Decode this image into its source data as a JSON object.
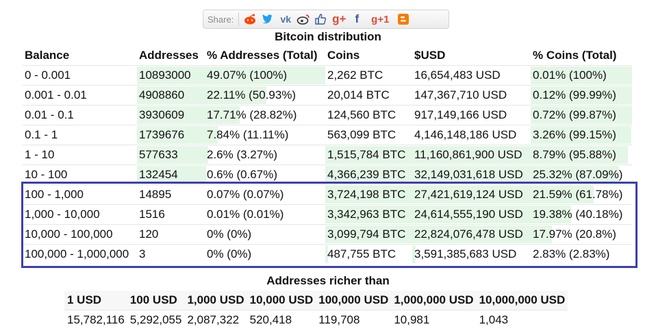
{
  "share": {
    "label": "Share:",
    "buttons": [
      {
        "name": "reddit-icon",
        "color": "#ff4500"
      },
      {
        "name": "twitter-icon",
        "color": "#1da1f2"
      },
      {
        "name": "vk-icon",
        "color": "#4c75a3"
      },
      {
        "name": "weibo-icon",
        "color": "#e6162d"
      },
      {
        "name": "like-icon",
        "color": "#3b5998"
      },
      {
        "name": "google-plus-icon",
        "color": "#dd4b39"
      },
      {
        "name": "facebook-icon",
        "color": "#3b5998"
      },
      {
        "name": "google-plus-one-icon",
        "color": "#dd4b39"
      },
      {
        "name": "blogger-icon",
        "color": "#f57d00"
      }
    ]
  },
  "distribution": {
    "title": "Bitcoin distribution",
    "headers": [
      "Balance",
      "Addresses",
      "% Addresses (Total)",
      "Coins",
      "$USD",
      "% Coins (Total)"
    ],
    "bar_color": "#e4f6e6",
    "highlight_color": "#3d3fb0",
    "rows": [
      {
        "balance": "0 - 0.001",
        "addresses": "10893000",
        "pct_addresses": "49.07% (100%)",
        "coins": "2,262 BTC",
        "usd": "16,654,483 USD",
        "pct_coins": "0.01% (100%)",
        "addr_share": 1.0,
        "pct_share": 1.0,
        "coins_share": 0.0,
        "usd_share": 0.0,
        "pctc_share": 1.0
      },
      {
        "balance": "0.001 - 0.01",
        "addresses": "4908860",
        "pct_addresses": "22.11% (50.93%)",
        "coins": "20,014 BTC",
        "usd": "147,367,710 USD",
        "pct_coins": "0.12% (99.99%)",
        "addr_share": 1.0,
        "pct_share": 0.51,
        "coins_share": 0.0,
        "usd_share": 0.0,
        "pctc_share": 1.0
      },
      {
        "balance": "0.01 - 0.1",
        "addresses": "3930609",
        "pct_addresses": "17.71% (28.82%)",
        "coins": "124,560 BTC",
        "usd": "917,149,166 USD",
        "pct_coins": "0.72% (99.87%)",
        "addr_share": 1.0,
        "pct_share": 0.29,
        "coins_share": 0.0,
        "usd_share": 0.0,
        "pctc_share": 1.0
      },
      {
        "balance": "0.1 - 1",
        "addresses": "1739676",
        "pct_addresses": "7.84% (11.11%)",
        "coins": "563,099 BTC",
        "usd": "4,146,148,186 USD",
        "pct_coins": "3.26% (99.15%)",
        "addr_share": 1.0,
        "pct_share": 0.11,
        "coins_share": 0.0,
        "usd_share": 0.0,
        "pctc_share": 0.99
      },
      {
        "balance": "1 - 10",
        "addresses": "577633",
        "pct_addresses": "2.6% (3.27%)",
        "coins": "1,515,784 BTC",
        "usd": "11,160,861,900 USD",
        "pct_coins": "8.79% (95.88%)",
        "addr_share": 1.0,
        "pct_share": 0.03,
        "coins_share": 1.0,
        "usd_share": 1.0,
        "pctc_share": 0.96
      },
      {
        "balance": "10 - 100",
        "addresses": "132454",
        "pct_addresses": "0.6% (0.67%)",
        "coins": "4,366,239 BTC",
        "usd": "32,149,031,618 USD",
        "pct_coins": "25.32% (87.09%)",
        "addr_share": 1.0,
        "pct_share": 0.01,
        "coins_share": 1.0,
        "usd_share": 1.0,
        "pctc_share": 0.87
      },
      {
        "balance": "100 - 1,000",
        "addresses": "14895",
        "pct_addresses": "0.07% (0.07%)",
        "coins": "3,724,198 BTC",
        "usd": "27,421,619,124 USD",
        "pct_coins": "21.59% (61.78%)",
        "addr_share": 0.0,
        "pct_share": 0.0,
        "coins_share": 1.0,
        "usd_share": 1.0,
        "pctc_share": 0.62
      },
      {
        "balance": "1,000 - 10,000",
        "addresses": "1516",
        "pct_addresses": "0.01% (0.01%)",
        "coins": "3,342,963 BTC",
        "usd": "24,614,555,190 USD",
        "pct_coins": "19.38% (40.18%)",
        "addr_share": 0.0,
        "pct_share": 0.0,
        "coins_share": 1.0,
        "usd_share": 1.0,
        "pctc_share": 0.4
      },
      {
        "balance": "10,000 - 100,000",
        "addresses": "120",
        "pct_addresses": "0% (0%)",
        "coins": "3,099,794 BTC",
        "usd": "22,824,076,478 USD",
        "pct_coins": "17.97% (20.8%)",
        "addr_share": 0.0,
        "pct_share": 0.0,
        "coins_share": 1.0,
        "usd_share": 1.0,
        "pctc_share": 0.21
      },
      {
        "balance": "100,000 - 1,000,000",
        "addresses": "3",
        "pct_addresses": "0% (0%)",
        "coins": "487,755 BTC",
        "usd": "3,591,385,683 USD",
        "pct_coins": "2.83% (2.83%)",
        "addr_share": 0.0,
        "pct_share": 0.0,
        "coins_share": 0.03,
        "usd_share": 0.03,
        "pctc_share": 0.0
      }
    ]
  },
  "richer": {
    "title": "Addresses richer than",
    "headers": [
      "1 USD",
      "100 USD",
      "1,000 USD",
      "10,000 USD",
      "100,000 USD",
      "1,000,000 USD",
      "10,000,000 USD"
    ],
    "values": [
      "15,782,116",
      "5,292,055",
      "2,087,322",
      "520,418",
      "119,708",
      "10,981",
      "1,043"
    ]
  }
}
